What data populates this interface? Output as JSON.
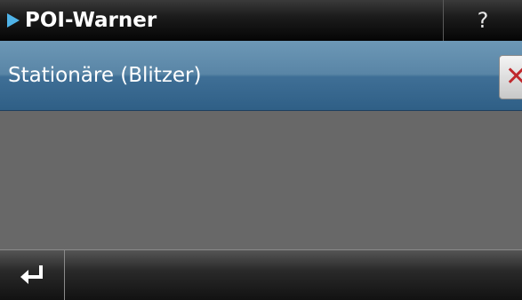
{
  "header": {
    "title": "POI-Warner",
    "title_icon": "play-icon",
    "help_label": "?"
  },
  "list": {
    "items": [
      {
        "label": "Stationäre (Blitzer)",
        "selected": true,
        "action_icon": "delete-icon",
        "action_glyph": "✕"
      }
    ]
  },
  "footer": {
    "back_icon": "return-arrow-icon"
  },
  "colors": {
    "accent": "#4fb3e8",
    "selected_row": "#4a7aa0",
    "delete": "#c0282c",
    "background": "#686868"
  }
}
